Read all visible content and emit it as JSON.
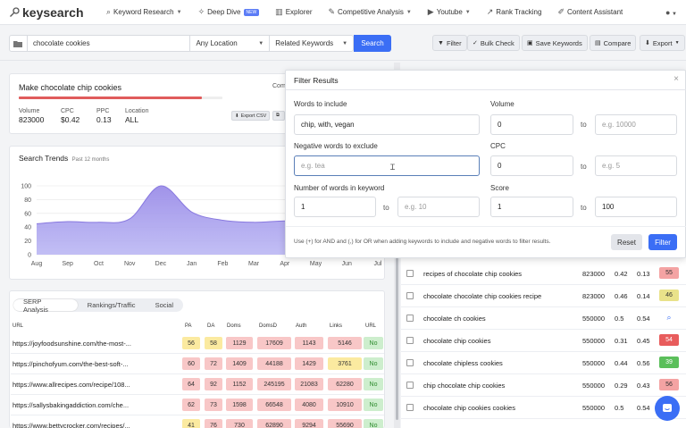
{
  "nav": {
    "brand": "keysearch",
    "items": [
      {
        "label": "Keyword Research",
        "icon": "search-icon",
        "caret": true
      },
      {
        "label": "Deep Dive",
        "icon": "dive-icon",
        "badge": "NEW"
      },
      {
        "label": "Explorer",
        "icon": "bar-chart-icon"
      },
      {
        "label": "Competitive Analysis",
        "icon": "wrench-icon",
        "caret": true
      },
      {
        "label": "Youtube",
        "icon": "youtube-icon",
        "caret": true
      },
      {
        "label": "Rank Tracking",
        "icon": "rank-chart-icon"
      },
      {
        "label": "Content Assistant",
        "icon": "pencil-icon"
      }
    ],
    "user_icon": "user-icon"
  },
  "search": {
    "keyword": "chocolate cookies",
    "location": "Any Location",
    "mode": "Related Keywords",
    "button": "Search"
  },
  "tools": {
    "filter": "Filter",
    "bulk_check": "Bulk Check",
    "save": "Save Keywords",
    "compare": "Compare",
    "export": "Export"
  },
  "summary": {
    "title": "Make chocolate chip cookies",
    "truncated_label": "Com",
    "volume_label": "Volume",
    "volume": "823000",
    "cpc_label": "CPC",
    "cpc": "$0.42",
    "ppc_label": "PPC",
    "ppc": "0.13",
    "location_label": "Location",
    "location": "ALL",
    "export_csv": "Export CSV",
    "progress_fraction": 0.9
  },
  "trends": {
    "title": "Search Trends",
    "subtitle": "Past 12 months",
    "chart_data": {
      "type": "area",
      "categories": [
        "Aug",
        "Sep",
        "Oct",
        "Nov",
        "Dec",
        "Jan",
        "Feb",
        "Mar",
        "Apr",
        "May",
        "Jun",
        "Jul"
      ],
      "values": [
        45,
        48,
        47,
        52,
        100,
        62,
        50,
        47,
        49,
        48,
        50,
        51
      ],
      "ylim": [
        0,
        100
      ],
      "yticks": [
        "0",
        "20",
        "40",
        "60",
        "80",
        "100"
      ],
      "color": "#9b8de8"
    }
  },
  "serp": {
    "tabs": [
      "SERP Analysis",
      "Rankings/Traffic",
      "Social"
    ],
    "columns": [
      "URL",
      "PA",
      "DA",
      "Doms",
      "DomsD",
      "Auth",
      "Links",
      "URL"
    ],
    "rows": [
      {
        "url": "https://joyfoodsunshine.com/the-most-...",
        "pa": "56",
        "da": "58",
        "doms": "1129",
        "domsd": "17609",
        "auth": "1143",
        "links": "5146",
        "flag": "No"
      },
      {
        "url": "https://pinchofyum.com/the-best-soft-...",
        "pa": "60",
        "da": "72",
        "doms": "1409",
        "domsd": "44188",
        "auth": "1429",
        "links": "3761",
        "flag": "No"
      },
      {
        "url": "https://www.allrecipes.com/recipe/108...",
        "pa": "64",
        "da": "92",
        "doms": "1152",
        "domsd": "245195",
        "auth": "21083",
        "links": "62280",
        "flag": "No"
      },
      {
        "url": "https://sallysbakingaddiction.com/che...",
        "pa": "62",
        "da": "73",
        "doms": "1598",
        "domsd": "66548",
        "auth": "4080",
        "links": "10910",
        "flag": "No"
      },
      {
        "url": "https://www.bettycrocker.com/recipes/...",
        "pa": "41",
        "da": "76",
        "doms": "730",
        "domsd": "62890",
        "auth": "9294",
        "links": "55690",
        "flag": "No"
      }
    ]
  },
  "keywords": [
    {
      "kw": "recipes of chocolate chip cookies",
      "vol": "823000",
      "cpc": "0.42",
      "ppc": "0.13",
      "score": "55",
      "color": "#f4a3a3"
    },
    {
      "kw": "chocolate chocolate chip cookies recipe",
      "vol": "823000",
      "cpc": "0.46",
      "ppc": "0.14",
      "score": "46",
      "color": "#e9e28a"
    },
    {
      "kw": "chocolate ch cookies",
      "vol": "550000",
      "cpc": "0.5",
      "ppc": "0.54",
      "score": "",
      "color": ""
    },
    {
      "kw": "chocolate chip cookies",
      "vol": "550000",
      "cpc": "0.31",
      "ppc": "0.45",
      "score": "54",
      "color": "#e85c5c"
    },
    {
      "kw": "chocolate chipless cookies",
      "vol": "550000",
      "cpc": "0.44",
      "ppc": "0.56",
      "score": "39",
      "color": "#5bbf5b"
    },
    {
      "kw": "chip chocolate chip cookies",
      "vol": "550000",
      "cpc": "0.29",
      "ppc": "0.43",
      "score": "56",
      "color": "#f4a3a3"
    },
    {
      "kw": "chocolate chip cookies cookies",
      "vol": "550000",
      "cpc": "0.5",
      "ppc": "0.54",
      "score": "",
      "color": ""
    }
  ],
  "filter": {
    "title": "Filter Results",
    "include_label": "Words to include",
    "include_value": "chip, with, vegan",
    "exclude_label": "Negative words to exclude",
    "exclude_placeholder": "e.g. tea",
    "words_label": "Number of words in keyword",
    "words_min": "1",
    "words_max_placeholder": "e.g. 10",
    "volume_label": "Volume",
    "volume_min": "0",
    "volume_max_placeholder": "e.g. 10000",
    "cpc_label": "CPC",
    "cpc_min": "0",
    "cpc_max_placeholder": "e.g. 5",
    "score_label": "Score",
    "score_min": "1",
    "score_max": "100",
    "to": "to",
    "help": "Use (+) for AND and (,) for OR when adding keywords to include and negative words to filter results.",
    "reset": "Reset",
    "apply": "Filter",
    "close": "×"
  }
}
